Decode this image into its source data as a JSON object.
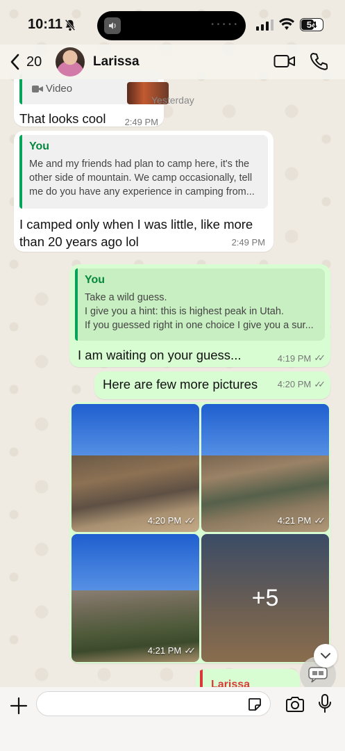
{
  "status_bar": {
    "time": "10:11",
    "battery": "54"
  },
  "header": {
    "unread_count": "20",
    "contact_name": "Larissa"
  },
  "date_label": "Yesterday",
  "messages": {
    "m1": {
      "quote_type": "Video",
      "text": "That looks cool",
      "time": "2:49 PM"
    },
    "m2": {
      "quote_author": "You",
      "quote_lines": [
        "Me and my friends had plan to camp here, it's the",
        "other side of mountain. We camp occasionally, tell",
        "me do you have any experience in camping from..."
      ],
      "text": "I camped only when I was little, like more than 20 years ago lol",
      "time": "2:49 PM"
    },
    "m3": {
      "quote_author": "You",
      "quote_lines": [
        "Take a wild guess.",
        "I give you a hint: this is highest peak in Utah.",
        "If you guessed right in one choice I give you a sur..."
      ],
      "text": "I am waiting on your guess...",
      "time": "4:19 PM"
    },
    "m4": {
      "text": "Here are few more pictures",
      "time": "4:20 PM"
    },
    "photos": [
      {
        "time": "4:20 PM"
      },
      {
        "time": "4:21 PM"
      },
      {
        "time": "4:21 PM"
      },
      {
        "more": "+5"
      }
    ],
    "m5": {
      "quote_author": "Larissa"
    }
  },
  "composer": {
    "placeholder": ""
  },
  "colors": {
    "outgoing_bubble": "#d9fdd3",
    "incoming_bubble": "#ffffff",
    "accent": "#06873f"
  }
}
